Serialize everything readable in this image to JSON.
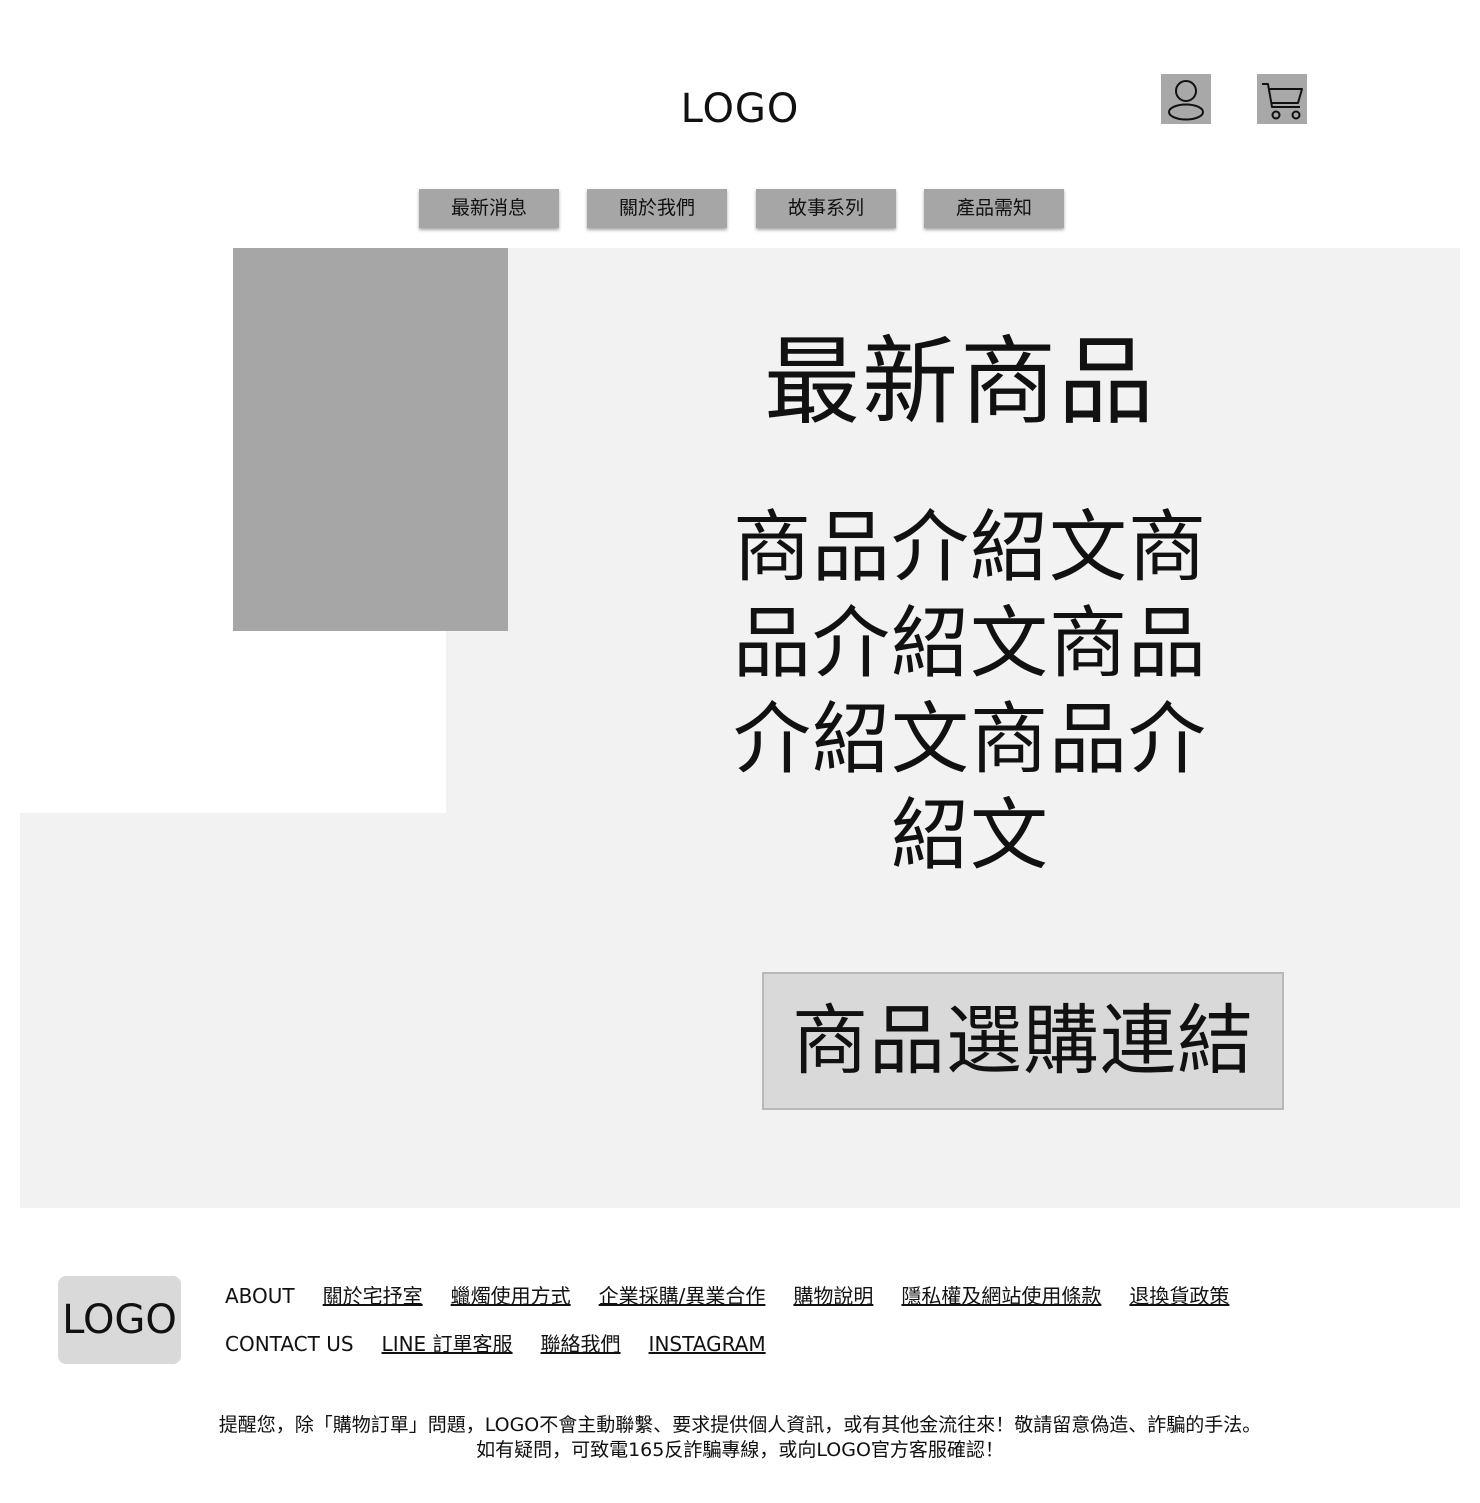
{
  "header": {
    "logo": "LOGO",
    "icons": {
      "account": "user-icon",
      "cart": "cart-icon"
    }
  },
  "nav": {
    "items": [
      {
        "label": "最新消息"
      },
      {
        "label": "關於我們"
      },
      {
        "label": "故事系列"
      },
      {
        "label": "產品需知"
      }
    ]
  },
  "hero": {
    "title": "最新商品",
    "description": "商品介紹文商品介紹文商品介紹文商品介紹文",
    "buy_link": "商品選購連結"
  },
  "footer": {
    "logo": "LOGO",
    "about": {
      "heading": "ABOUT",
      "links": [
        "關於宅抒室",
        "蠟燭使用方式",
        "企業採購/異業合作",
        "購物說明",
        "隱私權及網站使用條款",
        "退換貨政策"
      ]
    },
    "contact": {
      "heading": "CONTACT US",
      "links": [
        "LINE 訂單客服",
        "聯絡我們",
        "INSTAGRAM"
      ]
    },
    "notice_line1": "提醒您，除「購物訂單」問題，LOGO不會主動聯繫、要求提供個人資訊，或有其他金流往來！敬請留意偽造、詐騙的手法。",
    "notice_line2": "如有疑問，可致電165反詐騙專線，或向LOGO官方客服確認！"
  },
  "colors": {
    "placeholder_gray": "#a6a6a6",
    "panel_bg": "#f2f2f2",
    "button_bg": "#d9d9d9"
  }
}
